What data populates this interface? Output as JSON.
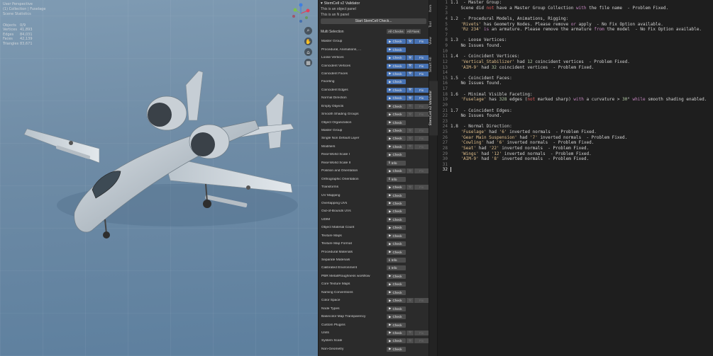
{
  "viewport": {
    "info": [
      "User Perspective",
      "(1) Collection | Fuselage",
      "Scene Statistics"
    ],
    "stats": [
      [
        "Objects",
        "0/9"
      ],
      [
        "Vertices",
        "41,893"
      ],
      [
        "Edges",
        "84,031"
      ],
      [
        "Faces",
        "42,139"
      ],
      [
        "Triangles",
        "83,671"
      ]
    ],
    "gizmo": {
      "x_color": "#e2415a",
      "y_color": "#7fc14c",
      "z_color": "#3f7fe0"
    },
    "nav_icons": [
      "zoom-icon",
      "hand-icon",
      "camera-icon",
      "grid-icon"
    ]
  },
  "panel": {
    "title": "StemCell v2 Validator",
    "sub1": "This is an object panel",
    "sub2": "This is an N panel",
    "start_button": "Start StemCell Check...",
    "multi_selection": "Multi Selection",
    "all_checks": "All Checks",
    "all_fixes": "All Fixes",
    "rows": [
      {
        "label": "Master Group",
        "btn": "Check",
        "on": true,
        "fix": "on"
      },
      {
        "label": "Procedural, Animations, ...",
        "btn": "Check",
        "on": true,
        "fix": "none"
      },
      {
        "label": "Loose Vertices",
        "btn": "Check",
        "on": true,
        "fix": "on"
      },
      {
        "label": "Coincident Vertices",
        "btn": "Check",
        "on": true,
        "fix": "on"
      },
      {
        "label": "Coincident Faces",
        "btn": "Check",
        "on": true,
        "fix": "on"
      },
      {
        "label": "Faceting",
        "btn": "Check",
        "on": true,
        "fix": "none"
      },
      {
        "label": "Coincident Edges",
        "btn": "Check",
        "on": true,
        "fix": "on"
      },
      {
        "label": "Normal Direction",
        "btn": "Check",
        "on": true,
        "fix": "on"
      },
      {
        "label": "Empty Objects",
        "btn": "Check",
        "on": false,
        "fix": "dim"
      },
      {
        "label": "Smooth Shading Groups",
        "btn": "Check",
        "on": false,
        "fix": "dim"
      },
      {
        "label": "Object Organization",
        "btn": "Check",
        "on": false,
        "fix": "none"
      },
      {
        "label": "Master Group",
        "btn": "Check",
        "on": false,
        "fix": "dim"
      },
      {
        "label": "Single Non Default Layer",
        "btn": "Check",
        "on": false,
        "fix": "dim"
      },
      {
        "label": "Modifiers",
        "btn": "Check",
        "on": false,
        "fix": "dim"
      },
      {
        "label": "Real-World Scale I",
        "btn": "Check",
        "on": false,
        "fix": "none"
      },
      {
        "label": "Real-World Scale II",
        "btn": "Info",
        "on": false,
        "fix": "none"
      },
      {
        "label": "Position and Orientation",
        "btn": "Check",
        "on": false,
        "fix": "dim"
      },
      {
        "label": "Orthographic Orientation",
        "btn": "Info",
        "on": false,
        "fix": "none"
      },
      {
        "label": "Transforms",
        "btn": "Check",
        "on": false,
        "fix": "dim"
      },
      {
        "label": "UV Mapping",
        "btn": "Check",
        "on": false,
        "fix": "none"
      },
      {
        "label": "Overlapping UVs",
        "btn": "Check",
        "on": false,
        "fix": "none"
      },
      {
        "label": "Out-of-Bounds UVs",
        "btn": "Check",
        "on": false,
        "fix": "none"
      },
      {
        "label": "UDIM",
        "btn": "Check",
        "on": false,
        "fix": "none"
      },
      {
        "label": "Object Material Count",
        "btn": "Check",
        "on": false,
        "fix": "none"
      },
      {
        "label": "Texture Maps",
        "btn": "Check",
        "on": false,
        "fix": "none"
      },
      {
        "label": "Texture Map Format",
        "btn": "Check",
        "on": false,
        "fix": "none"
      },
      {
        "label": "Procedural Materials",
        "btn": "Check",
        "on": false,
        "fix": "none"
      },
      {
        "label": "Separate Materials",
        "btn": "Info",
        "on": false,
        "fix": "none"
      },
      {
        "label": "Calibrated Environment",
        "btn": "Info",
        "on": false,
        "fix": "none"
      },
      {
        "label": "PBR Metal/Roughness workflow",
        "btn": "Check",
        "on": false,
        "fix": "none"
      },
      {
        "label": "Core Texture Maps",
        "btn": "Check",
        "on": false,
        "fix": "none"
      },
      {
        "label": "Naming Conventions",
        "btn": "Check",
        "on": false,
        "fix": "none"
      },
      {
        "label": "Color Space",
        "btn": "Check",
        "on": false,
        "fix": "dim"
      },
      {
        "label": "Node Types",
        "btn": "Check",
        "on": false,
        "fix": "none"
      },
      {
        "label": "Basecolor Map Transparency",
        "btn": "Check",
        "on": false,
        "fix": "none"
      },
      {
        "label": "Custom Plugins",
        "btn": "Check",
        "on": false,
        "fix": "none"
      },
      {
        "label": "Units",
        "btn": "Check",
        "on": false,
        "fix": "dim"
      },
      {
        "label": "System Scale",
        "btn": "Check",
        "on": false,
        "fix": "dim"
      },
      {
        "label": "Non-Geometry",
        "btn": "Check",
        "on": false,
        "fix": "none"
      }
    ],
    "fix_label": "Fix"
  },
  "tabs": [
    "Item",
    "Tool",
    "View",
    "Smart Fill",
    "StemCell v2 Validator"
  ],
  "editor": {
    "current_line": "32",
    "lines": [
      [
        [
          "t",
          "1.1  - Master Group:"
        ]
      ],
      [
        [
          "t",
          "    Scene did "
        ],
        [
          "r",
          "not"
        ],
        [
          "t",
          " have a Master Group Collection "
        ],
        [
          "p",
          "with"
        ],
        [
          "t",
          " the file name  - Problem Fixed."
        ]
      ],
      [],
      [
        [
          "t",
          "1.2  - Procedural Models, Animations, Rigging:"
        ]
      ],
      [
        [
          "y",
          "    'Rivets'"
        ],
        [
          "t",
          " has Geometry Nodes. Please remove "
        ],
        [
          "p",
          "or"
        ],
        [
          "t",
          " apply  - No Fix Option available."
        ]
      ],
      [
        [
          "y",
          "    'Rz 234'"
        ],
        [
          "t",
          " "
        ],
        [
          "p",
          "is"
        ],
        [
          "t",
          " an armature. Please remove the armature "
        ],
        [
          "p",
          "from"
        ],
        [
          "t",
          " the model  - No Fix Option available."
        ]
      ],
      [],
      [
        [
          "t",
          "1.3  - Loose Vertices:"
        ]
      ],
      [
        [
          "t",
          "    No Issues found."
        ]
      ],
      [],
      [
        [
          "t",
          "1.4  - Coincident Vertices:"
        ]
      ],
      [
        [
          "y",
          "    'Vertical_Stabilizer'"
        ],
        [
          "t",
          " had "
        ],
        [
          "nm",
          "12"
        ],
        [
          "t",
          " coincident vertices  - Problem Fixed."
        ]
      ],
      [
        [
          "y",
          "    'AIM-9'"
        ],
        [
          "t",
          " had "
        ],
        [
          "nm",
          "32"
        ],
        [
          "t",
          " coincident vertices  - Problem Fixed."
        ]
      ],
      [],
      [
        [
          "t",
          "1.5  - Coincident Faces:"
        ]
      ],
      [
        [
          "t",
          "    No Issues found."
        ]
      ],
      [],
      [
        [
          "t",
          "1.6  - Minimal Visible Faceting:"
        ]
      ],
      [
        [
          "y",
          "    'Fuselage'"
        ],
        [
          "t",
          " has "
        ],
        [
          "nm",
          "328"
        ],
        [
          "t",
          " edges ("
        ],
        [
          "r",
          "not"
        ],
        [
          "t",
          " marked sharp) "
        ],
        [
          "p",
          "with"
        ],
        [
          "t",
          " a curvature > "
        ],
        [
          "nm",
          "30"
        ],
        [
          "t",
          "° "
        ],
        [
          "p",
          "while"
        ],
        [
          "t",
          " smooth shading enabled."
        ]
      ],
      [],
      [
        [
          "t",
          "1.7  - Coincident Edges:"
        ]
      ],
      [
        [
          "t",
          "    No Issues found."
        ]
      ],
      [],
      [
        [
          "t",
          "1.8  - Normal Direction:"
        ]
      ],
      [
        [
          "y",
          "    'Fuselage'"
        ],
        [
          "t",
          " had "
        ],
        [
          "y",
          "'6'"
        ],
        [
          "t",
          " inverted normals  - Problem Fixed."
        ]
      ],
      [
        [
          "y",
          "    'Gear Main Suspension'"
        ],
        [
          "t",
          " had "
        ],
        [
          "y",
          "'7'"
        ],
        [
          "t",
          " inverted normals  - Problem Fixed."
        ]
      ],
      [
        [
          "y",
          "    'Cowling'"
        ],
        [
          "t",
          " had "
        ],
        [
          "y",
          "'6'"
        ],
        [
          "t",
          " inverted normals  - Problem Fixed."
        ]
      ],
      [
        [
          "y",
          "    'Seat'"
        ],
        [
          "t",
          " had "
        ],
        [
          "y",
          "'22'"
        ],
        [
          "t",
          " inverted normals  - Problem Fixed."
        ]
      ],
      [
        [
          "y",
          "    'Wings'"
        ],
        [
          "t",
          " had "
        ],
        [
          "y",
          "'12'"
        ],
        [
          "t",
          " inverted normals  - Problem Fixed."
        ]
      ],
      [
        [
          "y",
          "    'AIM-9'"
        ],
        [
          "t",
          " had "
        ],
        [
          "y",
          "'8'"
        ],
        [
          "t",
          " inverted normals  - Problem Fixed."
        ]
      ],
      [],
      []
    ]
  }
}
